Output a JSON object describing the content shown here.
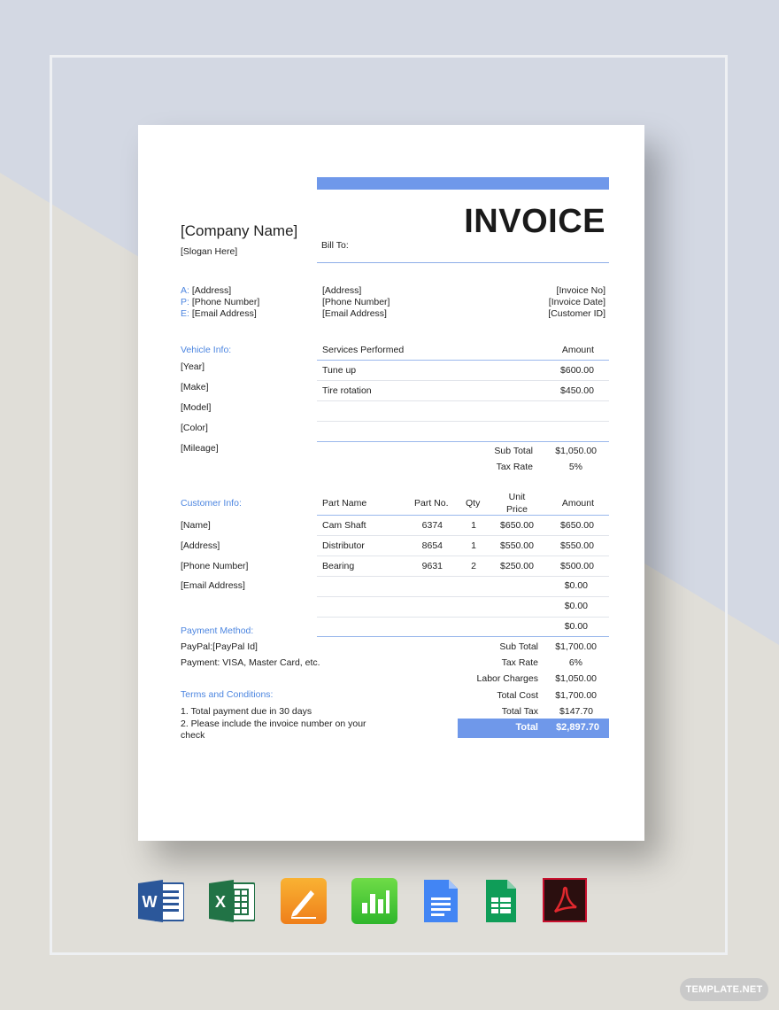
{
  "invoice": {
    "title": "INVOICE",
    "company_name": "[Company Name]",
    "slogan": "[Slogan Here]",
    "bill_to_label": "Bill To:",
    "contact": {
      "a_prefix": "A:",
      "address": "[Address]",
      "p_prefix": "P:",
      "phone": "[Phone Number]",
      "e_prefix": "E:",
      "email": "[Email Address]"
    },
    "bill_to": {
      "address": "[Address]",
      "phone": "[Phone Number]",
      "email": "[Email Address]"
    },
    "meta": {
      "invoice_no": "[Invoice No]",
      "invoice_date": "[Invoice Date]",
      "customer_id": "[Customer ID]"
    },
    "vehicle": {
      "label": "Vehicle Info:",
      "fields": [
        "[Year]",
        "[Make]",
        "[Model]",
        "[Color]",
        "[Mileage]"
      ]
    },
    "services": {
      "header_service": "Services Performed",
      "header_amount": "Amount",
      "rows": [
        {
          "name": "Tune up",
          "amount": "$600.00"
        },
        {
          "name": "Tire rotation",
          "amount": "$450.00"
        }
      ],
      "subtotal_label": "Sub Total",
      "subtotal": "$1,050.00",
      "taxrate_label": "Tax Rate",
      "taxrate": "5%"
    },
    "customer": {
      "label": "Customer Info:",
      "fields": [
        "[Name]",
        "[Address]",
        "[Phone Number]",
        "[Email Address]"
      ]
    },
    "parts": {
      "h_name": "Part Name",
      "h_no": "Part No.",
      "h_qty": "Qty",
      "h_unit_1": "Unit",
      "h_unit_2": "Price",
      "h_amount": "Amount",
      "rows": [
        {
          "name": "Cam Shaft",
          "no": "6374",
          "qty": "1",
          "unit": "$650.00",
          "amount": "$650.00"
        },
        {
          "name": "Distributor",
          "no": "8654",
          "qty": "1",
          "unit": "$550.00",
          "amount": "$550.00"
        },
        {
          "name": "Bearing",
          "no": "9631",
          "qty": "2",
          "unit": "$250.00",
          "amount": "$500.00"
        },
        {
          "name": "",
          "no": "",
          "qty": "",
          "unit": "",
          "amount": "$0.00"
        },
        {
          "name": "",
          "no": "",
          "qty": "",
          "unit": "",
          "amount": "$0.00"
        },
        {
          "name": "",
          "no": "",
          "qty": "",
          "unit": "",
          "amount": "$0.00"
        }
      ]
    },
    "summary": [
      {
        "label": "Sub Total",
        "value": "$1,700.00"
      },
      {
        "label": "Tax Rate",
        "value": "6%"
      },
      {
        "label": "Labor Charges",
        "value": "$1,050.00"
      },
      {
        "label": "Total Cost",
        "value": "$1,700.00"
      },
      {
        "label": "Total Tax",
        "value": "$147.70"
      }
    ],
    "total_label": "Total",
    "total_value": "$2,897.70",
    "payment": {
      "label": "Payment Method:",
      "line1": "PayPal:[PayPal Id]",
      "line2": "Payment: VISA, Master Card, etc."
    },
    "terms": {
      "label": "Terms and Conditions:",
      "line1": "1. Total payment due in 30 days",
      "line2a": "2. Please include the invoice number on your",
      "line2b": "check"
    }
  },
  "apps": [
    {
      "icon": "word-icon",
      "letter": "W"
    },
    {
      "icon": "excel-icon",
      "letter": "X"
    },
    {
      "icon": "pages-icon"
    },
    {
      "icon": "numbers-icon"
    },
    {
      "icon": "google-docs-icon"
    },
    {
      "icon": "google-sheets-icon"
    },
    {
      "icon": "pdf-icon"
    }
  ],
  "badge": "TEMPLATE.NET",
  "colors": {
    "accent": "#6f98ea",
    "label_blue": "#4d86e0",
    "background": "#d3d8e3"
  }
}
